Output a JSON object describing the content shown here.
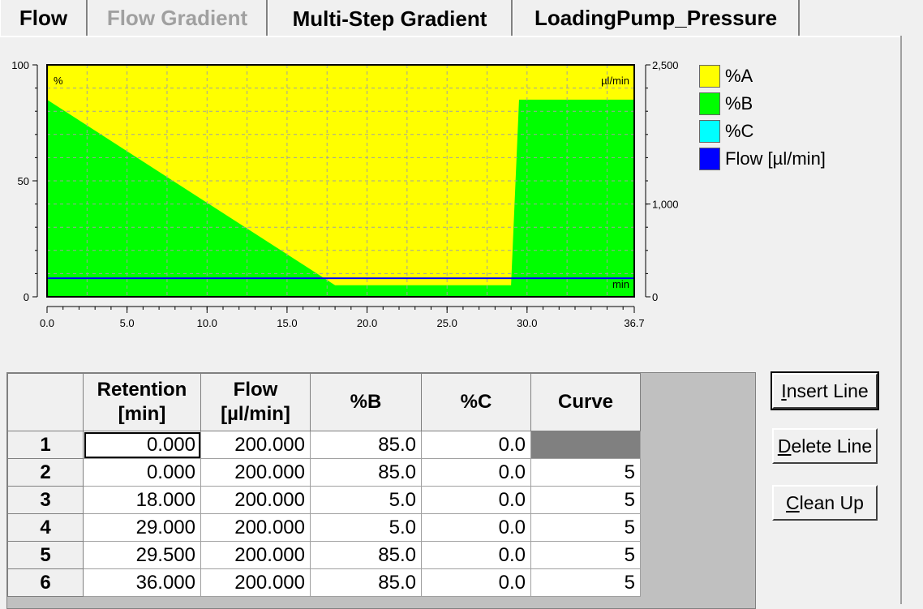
{
  "tabs": [
    {
      "label": "Flow",
      "state": "normal"
    },
    {
      "label": "Flow Gradient",
      "state": "disabled"
    },
    {
      "label": "Multi-Step Gradient",
      "state": "active"
    },
    {
      "label": "LoadingPump_Pressure",
      "state": "normal"
    }
  ],
  "chart_data": {
    "type": "area",
    "x_ticks": [
      "0.0",
      "5.0",
      "10.0",
      "15.0",
      "20.0",
      "25.0",
      "30.0",
      "36.7"
    ],
    "xlim": [
      0,
      36.7
    ],
    "y_left_ticks": [
      "100",
      "50",
      "0"
    ],
    "y_left_range": [
      0,
      100
    ],
    "y_left_unit": "%",
    "y_right_ticks": [
      "2,500",
      "1,000",
      "0"
    ],
    "y_right_range": [
      0,
      2500
    ],
    "y_right_unit": "µl/min",
    "x_unit": "min",
    "grid": true,
    "series": [
      {
        "name": "%B",
        "x": [
          0,
          0,
          18,
          29,
          29.5,
          36,
          36.7
        ],
        "values": [
          85,
          85,
          5,
          5,
          85,
          85,
          85
        ],
        "color": "#00ff00"
      },
      {
        "name": "Flow [µl/min]",
        "x": [
          0,
          36.7
        ],
        "values": [
          200,
          200
        ],
        "color": "#0000ff",
        "axis": "right"
      }
    ],
    "legend": [
      {
        "label": "%A",
        "color": "#ffff00"
      },
      {
        "label": "%B",
        "color": "#00ff00"
      },
      {
        "label": "%C",
        "color": "#00ffff"
      },
      {
        "label": "Flow [µl/min]",
        "color": "#0000ff"
      }
    ],
    "legend_placement": "right"
  },
  "table": {
    "columns": [
      {
        "line1": "",
        "line2": ""
      },
      {
        "line1": "Retention",
        "line2": "[min]"
      },
      {
        "line1": "Flow",
        "line2": "[µl/min]"
      },
      {
        "line1": "%B",
        "line2": ""
      },
      {
        "line1": "%C",
        "line2": ""
      },
      {
        "line1": "Curve",
        "line2": ""
      }
    ],
    "rows": [
      {
        "n": "1",
        "retention": "0.000",
        "flow": "200.000",
        "b": "85.0",
        "c": "0.0",
        "curve": ""
      },
      {
        "n": "2",
        "retention": "0.000",
        "flow": "200.000",
        "b": "85.0",
        "c": "0.0",
        "curve": "5"
      },
      {
        "n": "3",
        "retention": "18.000",
        "flow": "200.000",
        "b": "5.0",
        "c": "0.0",
        "curve": "5"
      },
      {
        "n": "4",
        "retention": "29.000",
        "flow": "200.000",
        "b": "5.0",
        "c": "0.0",
        "curve": "5"
      },
      {
        "n": "5",
        "retention": "29.500",
        "flow": "200.000",
        "b": "85.0",
        "c": "0.0",
        "curve": "5"
      },
      {
        "n": "6",
        "retention": "36.000",
        "flow": "200.000",
        "b": "85.0",
        "c": "0.0",
        "curve": "5"
      }
    ]
  },
  "buttons": {
    "insert": {
      "mnemonic": "I",
      "rest": "nsert Line"
    },
    "delete": {
      "mnemonic": "D",
      "rest": "elete Line"
    },
    "cleanup": {
      "mnemonic": "C",
      "rest": "lean Up"
    }
  }
}
